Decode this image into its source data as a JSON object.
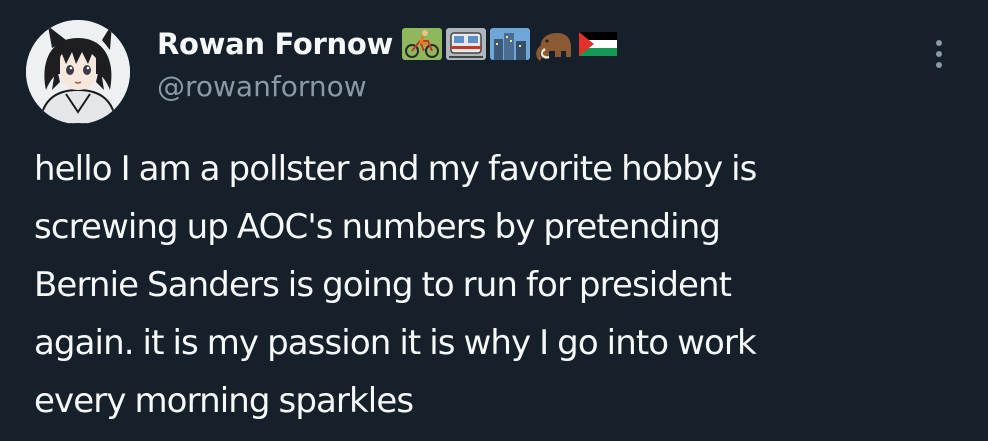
{
  "author": {
    "display_name": "Rowan Fornow",
    "handle": "@rowanfornow",
    "name_emojis": [
      "cyclist-icon",
      "tram-icon",
      "cityscape-icon",
      "mammoth-icon",
      "palestine-flag-icon"
    ]
  },
  "tweet": {
    "lines": [
      "hello I am a pollster and my favorite hobby is",
      "screwing up AOC's numbers by pretending",
      "Bernie Sanders is going to run for president",
      "again. it is my passion it is why I go into work",
      "every morning sparkles"
    ]
  },
  "colors": {
    "background": "#15202b",
    "text_primary": "#f7f9f9",
    "text_secondary": "#8b98a5"
  }
}
